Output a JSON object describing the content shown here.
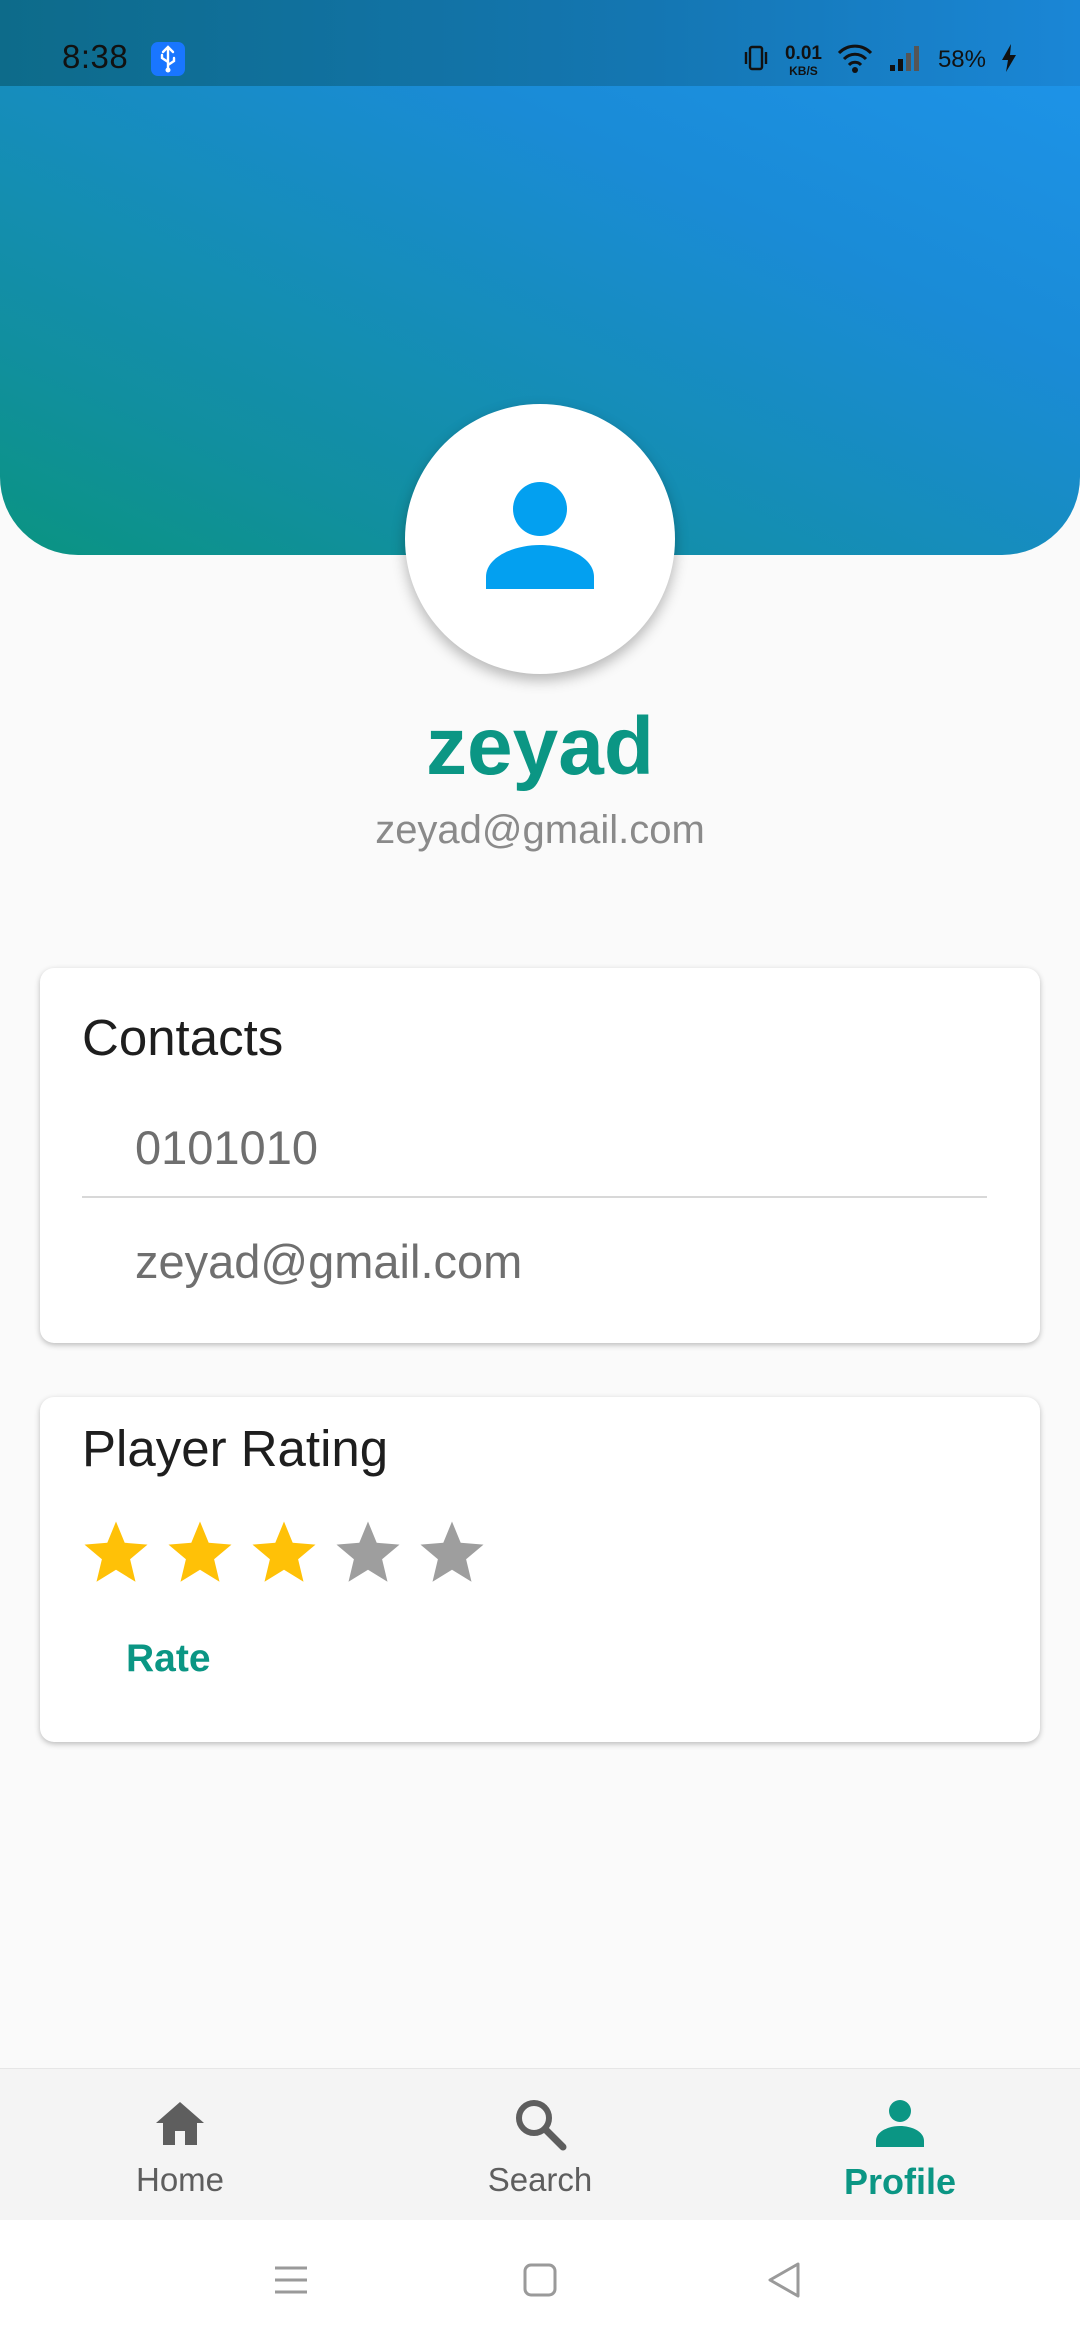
{
  "status_bar": {
    "time": "8:38",
    "net_speed_value": "0.01",
    "net_speed_unit": "KB/S",
    "battery": "58%",
    "icons": [
      "usb-icon",
      "vibrate-icon",
      "wifi-icon",
      "signal-icon",
      "charging-icon"
    ]
  },
  "profile": {
    "avatar_icon": "person-icon",
    "name": "zeyad",
    "email": "zeyad@gmail.com"
  },
  "contacts": {
    "title": "Contacts",
    "phone": "0101010",
    "email": "zeyad@gmail.com"
  },
  "rating": {
    "title": "Player Rating",
    "value": 3,
    "max": 5,
    "rate_label": "Rate"
  },
  "bottom_nav": {
    "items": [
      {
        "label": "Home",
        "icon": "home-icon",
        "active": false
      },
      {
        "label": "Search",
        "icon": "search-icon",
        "active": false
      },
      {
        "label": "Profile",
        "icon": "person-icon",
        "active": true
      }
    ]
  },
  "system_nav": {
    "icons": [
      "menu-icon",
      "home-square-icon",
      "back-triangle-icon"
    ]
  },
  "colors": {
    "accent": "#0b9684",
    "star_filled": "#ffc107",
    "star_empty": "#9e9e9e",
    "avatar_icon": "#03a0f0",
    "header_gradient_start": "#1e95ec",
    "header_gradient_end": "#0a9481"
  }
}
